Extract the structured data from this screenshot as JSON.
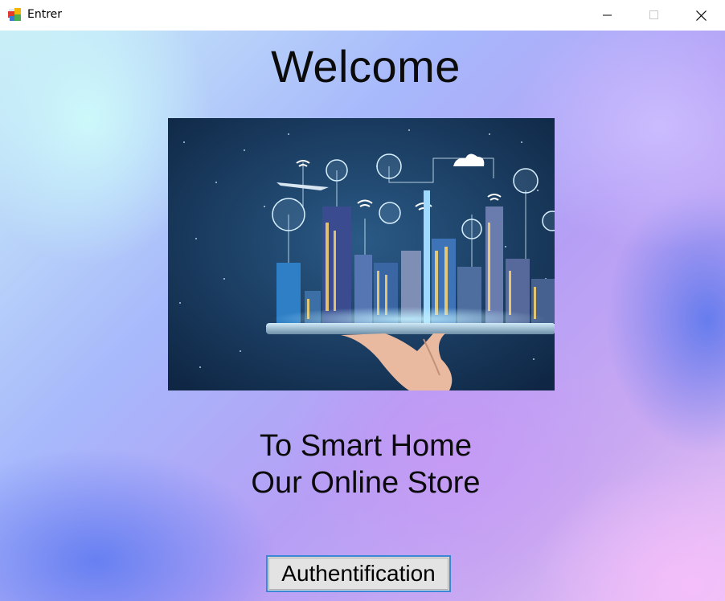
{
  "window": {
    "title": "Entrer",
    "icon": "winforms-app-icon",
    "controls": [
      "minimize-icon",
      "maximize-icon",
      "close-icon"
    ]
  },
  "main": {
    "heading": "Welcome",
    "image": "smart-city-on-tablet-image",
    "subtitle_line1": "To Smart Home",
    "subtitle_line2": "Our Online Store",
    "auth_button_label": "Authentification"
  },
  "colors": {
    "button_border": "#3c86d6",
    "button_face": "#e3e3e3",
    "text": "#0b0b0b"
  }
}
